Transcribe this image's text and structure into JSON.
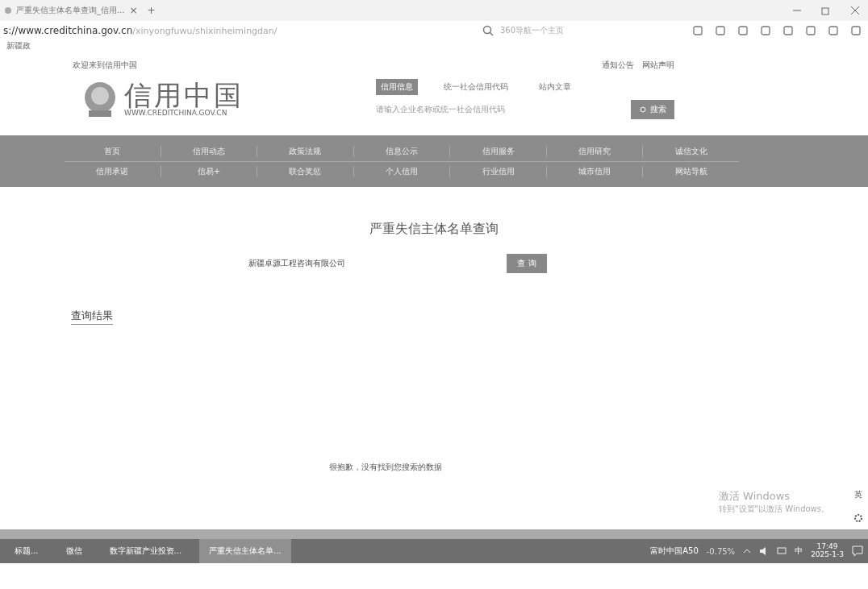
{
  "browser": {
    "tab_title": "严重失信主体名单查询_信用...",
    "tab_close": "×",
    "new_tab": "+",
    "url_host": "s://www.creditchina.gov.cn",
    "url_path": "/xinyongfuwu/shixinheimingdan/",
    "search_placeholder": "360导航一个主页",
    "bookmark": "新疆政"
  },
  "site": {
    "welcome": "欢迎来到信用中国",
    "top_links": [
      "通知公告",
      "网站声明"
    ],
    "logo_title": "信用中国",
    "logo_sub": "WWW.CREDITCHINA.GOV.CN",
    "search_tabs": [
      {
        "label": "信用信息",
        "selected": true
      },
      {
        "label": "统一社会信用代码",
        "selected": false
      },
      {
        "label": "站内文章",
        "selected": false
      }
    ],
    "search_placeholder": "请输入企业名称或统一社会信用代码",
    "search_button": "搜索",
    "nav_rows": [
      [
        "首页",
        "信用动态",
        "政策法规",
        "信息公示",
        "信用服务",
        "信用研究",
        "诚信文化"
      ],
      [
        "信用承诺",
        "信易+",
        "联合奖惩",
        "个人信用",
        "行业信用",
        "城市信用",
        "网站导航"
      ]
    ]
  },
  "query": {
    "title": "严重失信主体名单查询",
    "value": "新疆卓源工程咨询有限公司",
    "button": "查 询",
    "results_heading": "查询结果",
    "empty_message": "很抱歉，没有找到您搜索的数据"
  },
  "side_icons": [
    "英"
  ],
  "activation": {
    "title": "激活 Windows",
    "text": "转到\"设置\"以激活 Windows。"
  },
  "taskbar": {
    "apps": [
      {
        "label": "标题...",
        "selected": false
      },
      {
        "label": "微信",
        "selected": false
      },
      {
        "label": "数字新疆产业投资...",
        "selected": false
      },
      {
        "label": "严重失信主体名单...",
        "selected": true
      }
    ],
    "ticker_name": "富时中国A50",
    "ticker_change": "-0.75%",
    "ime": "中",
    "time": "17:49",
    "date": "2025-1-3"
  }
}
